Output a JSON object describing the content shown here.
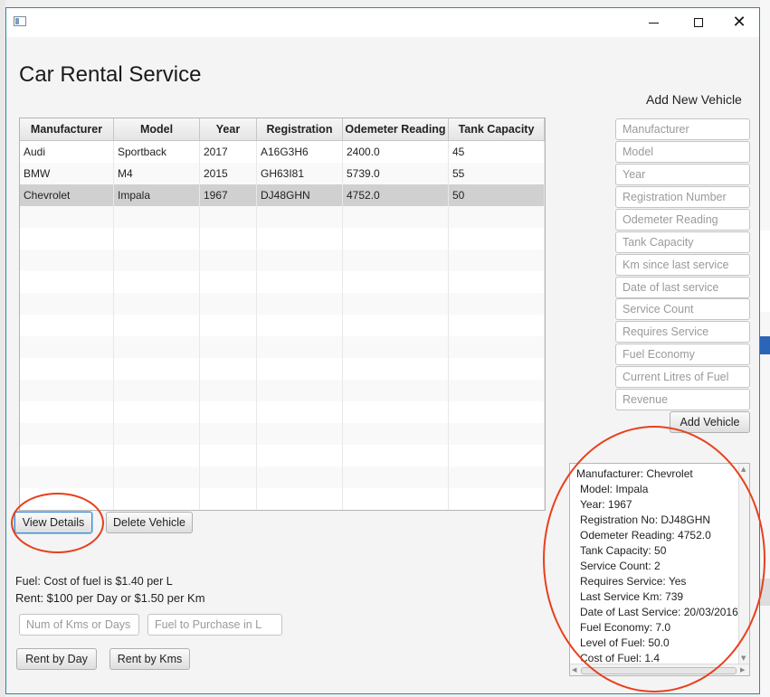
{
  "app": {
    "title": "Car Rental Service"
  },
  "window_controls": {
    "minimize_icon": "minimize-icon",
    "maximize_icon": "maximize-icon",
    "close_glyph": "✕"
  },
  "table": {
    "columns": [
      "Manufacturer",
      "Model",
      "Year",
      "Registration",
      "Odemeter Reading",
      "Tank Capacity"
    ],
    "rows": [
      [
        "Audi",
        "Sportback",
        "2017",
        "A16G3H6",
        "2400.0",
        "45"
      ],
      [
        "BMW",
        "M4",
        "2015",
        "GH63I81",
        "5739.0",
        "55"
      ],
      [
        "Chevrolet",
        "Impala",
        "1967",
        "DJ48GHN",
        "4752.0",
        "50"
      ]
    ],
    "selected_row_index": 2
  },
  "buttons": {
    "view_details": "View Details",
    "delete_vehicle": "Delete Vehicle",
    "add_vehicle": "Add Vehicle",
    "rent_by_day": "Rent by Day",
    "rent_by_kms": "Rent by Kms"
  },
  "add_form": {
    "heading": "Add New Vehicle",
    "placeholders": {
      "manufacturer": "Manufacturer",
      "model": "Model",
      "year": "Year",
      "registration": "Registration Number",
      "odometer": "Odemeter Reading",
      "tank": "Tank Capacity",
      "km_since": "Km since last service",
      "date_last": "Date of last service",
      "service_count": "Service Count",
      "requires_service": "Requires Service",
      "fuel_economy": "Fuel Economy",
      "current_fuel": "Current Litres of Fuel",
      "revenue": "Revenue"
    }
  },
  "rental": {
    "fuel_info": "Fuel: Cost of fuel is $1.40 per L",
    "rent_info": "Rent: $100 per Day or $1.50 per Km",
    "kms_placeholder": "Num of Kms or Days",
    "fuel_placeholder": "Fuel to Purchase in L"
  },
  "details": {
    "lines": [
      "Manufacturer: Chevrolet",
      "Model: Impala",
      "Year: 1967",
      "Registration No: DJ48GHN",
      "Odemeter Reading: 4752.0",
      "Tank Capacity: 50",
      "Service Count: 2",
      "Requires Service: Yes",
      "Last Service Km: 739",
      "Date of Last Service: 20/03/2016",
      "Fuel Economy: 7.0",
      "Level of Fuel: 50.0",
      "Cost of Fuel: 1.4"
    ]
  },
  "colors": {
    "annotation": "#e8401c",
    "window_border": "#1e8ea3",
    "selected_row": "#d0d0d0"
  }
}
